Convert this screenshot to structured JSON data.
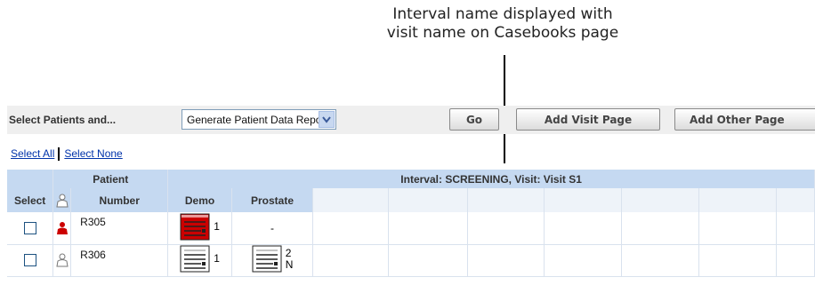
{
  "annotation": {
    "line1": "Interval name displayed with",
    "line2": "visit name on Casebooks page"
  },
  "toolbar": {
    "label": "Select Patients and...",
    "action_select": "Generate Patient Data Report",
    "go_label": "Go",
    "add_visit_label": "Add Visit Page",
    "add_other_label": "Add Other Page"
  },
  "links": {
    "select_all": "Select All",
    "select_none": "Select None"
  },
  "table": {
    "group_patient": "Patient",
    "group_interval": "Interval: SCREENING, Visit: Visit S1",
    "col_select": "Select",
    "col_number": "Number",
    "col_demo": "Demo",
    "col_prostate": "Prostate",
    "rows": [
      {
        "number": "R305",
        "demo_count": "1",
        "prostate": "-",
        "status_color": "#cc0000"
      },
      {
        "number": "R306",
        "demo_count": "1",
        "prostate_count": "2",
        "prostate_flag": "N"
      }
    ]
  },
  "colors": {
    "header_bg": "#c5d9f1",
    "toolbar_bg": "#efefef",
    "link": "#0033aa",
    "alert_red": "#cc0000"
  }
}
